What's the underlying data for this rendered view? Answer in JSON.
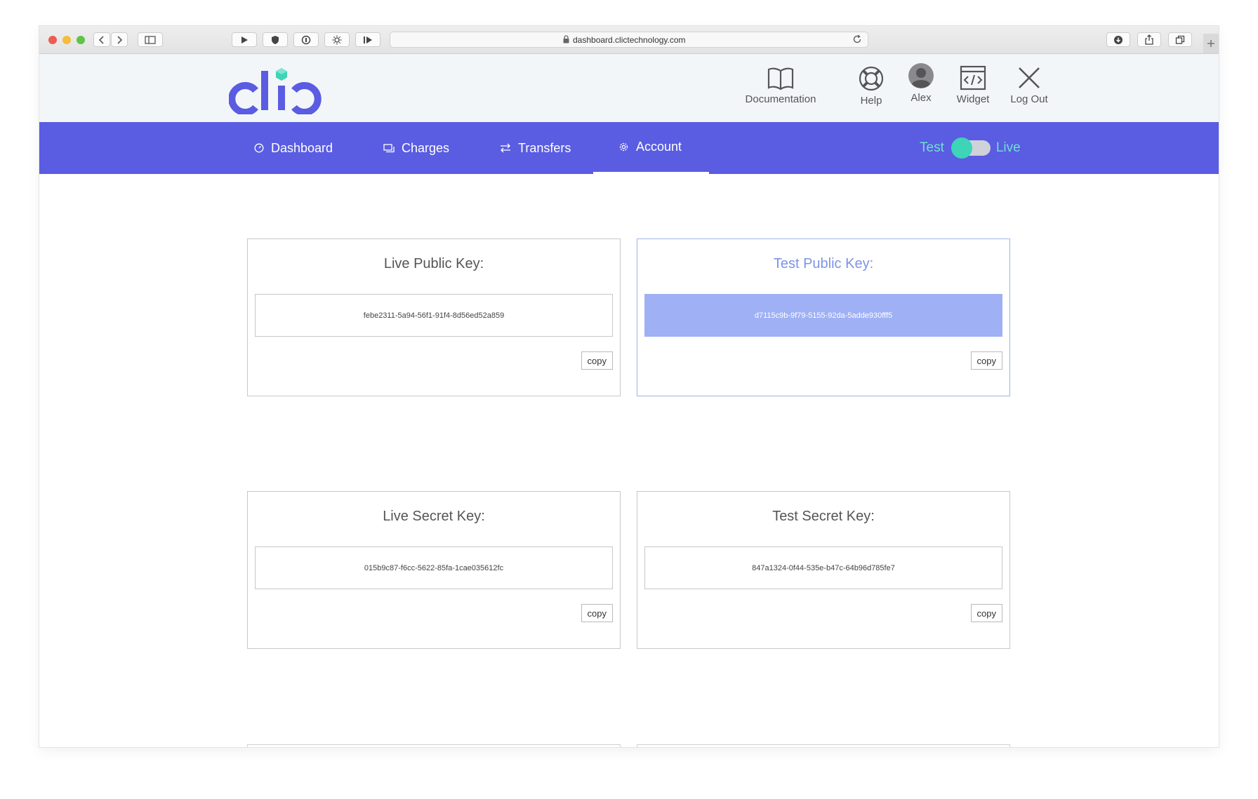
{
  "browser": {
    "url": "dashboard.clictechnology.com"
  },
  "brand": {
    "logo_text": "clic",
    "primary_color": "#5a5ce2",
    "accent_color": "#3dd4b8"
  },
  "header_nav": [
    {
      "label": "Documentation",
      "icon": "book-icon"
    },
    {
      "label": "Help",
      "icon": "lifebuoy-icon"
    },
    {
      "label": "Alex",
      "icon": "avatar-icon"
    },
    {
      "label": "Widget",
      "icon": "code-window-icon"
    },
    {
      "label": "Log Out",
      "icon": "close-icon"
    }
  ],
  "main_nav": {
    "items": [
      {
        "label": "Dashboard",
        "icon": "gauge-icon"
      },
      {
        "label": "Charges",
        "icon": "cards-icon"
      },
      {
        "label": "Transfers",
        "icon": "swap-arrows-icon"
      },
      {
        "label": "Account",
        "icon": "gear-icon",
        "active": true
      }
    ],
    "mode_toggle": {
      "left_label": "Test",
      "right_label": "Live"
    }
  },
  "keys": [
    {
      "title": "Live Public Key:",
      "value": "febe2311-5a94-56f1-91f4-8d56ed52a859",
      "copy_label": "copy"
    },
    {
      "title": "Test Public Key:",
      "value": "d7115c9b-9f79-5155-92da-5adde930fff5",
      "copy_label": "copy",
      "selected": true
    },
    {
      "title": "Live Secret Key:",
      "value": "015b9c87-f6cc-5622-85fa-1cae035612fc",
      "copy_label": "copy"
    },
    {
      "title": "Test Secret Key:",
      "value": "847a1324-0f44-535e-b47c-64b96d785fe7",
      "copy_label": "copy"
    }
  ]
}
